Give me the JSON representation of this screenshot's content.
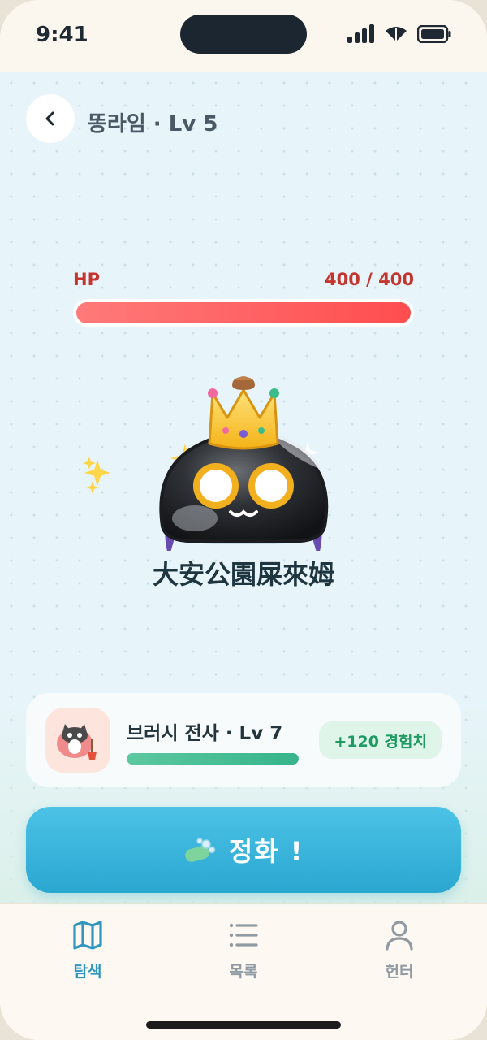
{
  "status_bar": {
    "time": "9:41"
  },
  "header": {
    "title": "똥라임 · Lv 5"
  },
  "boss": {
    "hp_label": "HP",
    "hp_value": "400 / 400",
    "hp_fraction": 1.0,
    "name": "大安公園屎來姆"
  },
  "hunter": {
    "name": "브러시 전사 · Lv 7",
    "exp_fraction": 1.0,
    "reward": "+120 경험치"
  },
  "action": {
    "label": "정화 !",
    "icon": "soap-bubbles-icon"
  },
  "tabs": [
    {
      "label": "탐색",
      "icon": "map-icon",
      "active": true
    },
    {
      "label": "목록",
      "icon": "list-icon",
      "active": false
    },
    {
      "label": "헌터",
      "icon": "person-icon",
      "active": false
    }
  ],
  "colors": {
    "accent": "#2aa7d1",
    "hp": "#ff4d4f",
    "exp": "#36b48a",
    "tab_active": "#2f96c0",
    "tab_inactive": "#8f9aa3"
  }
}
